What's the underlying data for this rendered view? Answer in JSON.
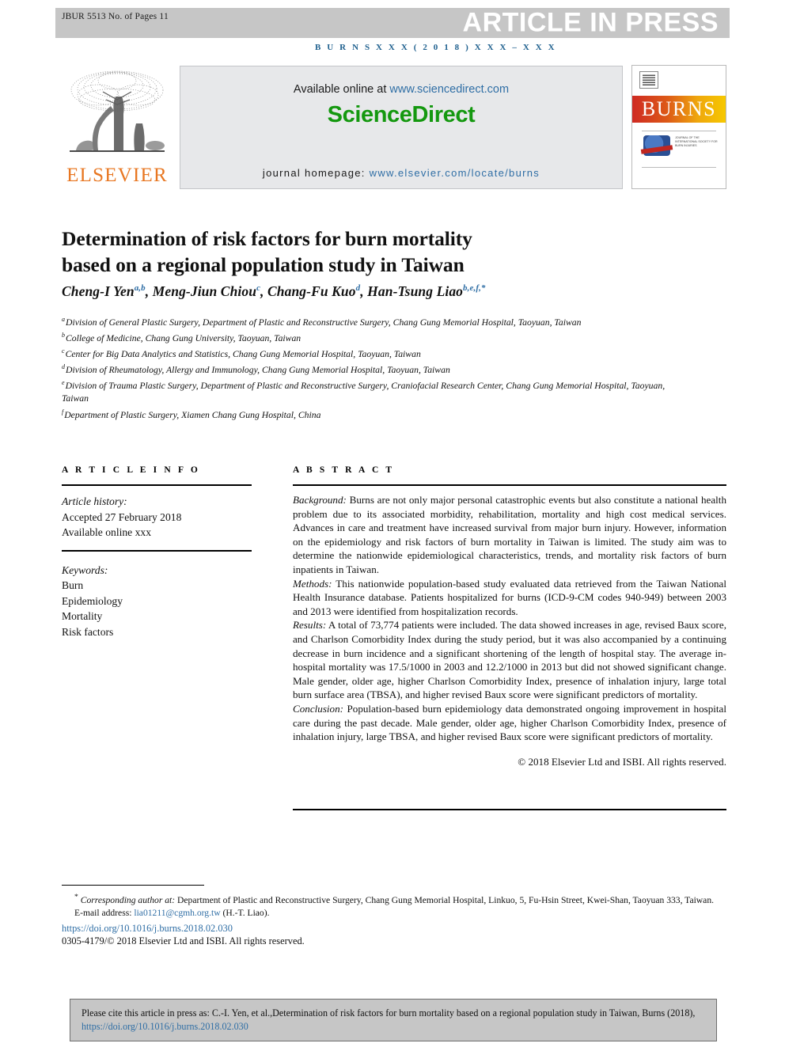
{
  "header": {
    "manuscript_id": "JBUR 5513 No. of Pages 11",
    "press_banner": "ARTICLE IN PRESS",
    "journal_ref": "B U R N S   X X X   ( 2 0 1 8 )   X X X – X X X"
  },
  "banner": {
    "publisher": "ELSEVIER",
    "available_prefix": "Available online at ",
    "available_link": "www.sciencedirect.com",
    "sciencedirect_logo": "ScienceDirect",
    "homepage_prefix": "journal homepage: ",
    "homepage_link": "www.elsevier.com/locate/burns",
    "cover_title": "BURNS",
    "cover_society": "JOURNAL OF THE INTERNATIONAL SOCIETY FOR BURN INJURIES",
    "colors": {
      "press_band": "#c6c6c6",
      "link_blue": "#2f6ea5",
      "sciencedirect_green": "#14980f",
      "elsevier_orange": "#e87722",
      "cover_band_start": "#cf2a23",
      "cover_band_end": "#f6c800"
    }
  },
  "article": {
    "title_line1": "Determination of risk factors for burn mortality",
    "title_line2": "based on a regional population study in Taiwan",
    "authors": [
      {
        "name": "Cheng-I Yen",
        "marks": "a,b",
        "sep": ", "
      },
      {
        "name": "Meng-Jiun Chiou",
        "marks": "c",
        "sep": ", "
      },
      {
        "name": "Chang-Fu Kuo",
        "marks": "d",
        "sep": ", "
      },
      {
        "name": "Han-Tsung Liao",
        "marks": "b,e,f,*",
        "sep": ""
      }
    ],
    "affiliations": [
      {
        "mark": "a",
        "text": "Division of General Plastic Surgery, Department of Plastic and Reconstructive Surgery, Chang Gung Memorial Hospital, Taoyuan, Taiwan"
      },
      {
        "mark": "b",
        "text": "College of Medicine, Chang Gung University, Taoyuan, Taiwan"
      },
      {
        "mark": "c",
        "text": "Center for Big Data Analytics and Statistics, Chang Gung Memorial Hospital, Taoyuan, Taiwan"
      },
      {
        "mark": "d",
        "text": "Division of Rheumatology, Allergy and Immunology, Chang Gung Memorial Hospital, Taoyuan, Taiwan"
      },
      {
        "mark": "e",
        "text": "Division of Trauma Plastic Surgery, Department of Plastic and Reconstructive Surgery, Craniofacial Research Center, Chang Gung Memorial Hospital, Taoyuan, Taiwan"
      },
      {
        "mark": "f",
        "text": "Department of Plastic Surgery, Xiamen Chang Gung Hospital, China"
      }
    ]
  },
  "article_info": {
    "heading": "A R T I C L E   I N F O",
    "history_label": "Article history:",
    "accepted": "Accepted 27 February 2018",
    "available_online": "Available online xxx",
    "keywords_label": "Keywords:",
    "keywords": [
      "Burn",
      "Epidemiology",
      "Mortality",
      "Risk factors"
    ]
  },
  "abstract": {
    "heading": "A B S T R A C T",
    "sections": [
      {
        "label": "Background:",
        "text": " Burns are not only major personal catastrophic events but also constitute a national health problem due to its associated morbidity, rehabilitation, mortality and high cost medical services. Advances in care and treatment have increased survival from major burn injury. However, information on the epidemiology and risk factors of burn mortality in Taiwan is limited. The study aim was to determine the nationwide epidemiological characteristics, trends, and mortality risk factors of burn inpatients in Taiwan."
      },
      {
        "label": "Methods:",
        "text": " This nationwide population-based study evaluated data retrieved from the Taiwan National Health Insurance database. Patients hospitalized for burns (ICD-9-CM codes 940-949) between 2003 and 2013 were identified from hospitalization records."
      },
      {
        "label": "Results:",
        "text": " A total of 73,774 patients were included. The data showed increases in age, revised Baux score, and Charlson Comorbidity Index during the study period, but it was also accompanied by a continuing decrease in burn incidence and a significant shortening of the length of hospital stay. The average in-hospital mortality was 17.5/1000 in 2003 and 12.2/1000 in 2013 but did not showed significant change. Male gender, older age, higher Charlson Comorbidity Index, presence of inhalation injury, large total burn surface area (TBSA), and higher revised Baux score were significant predictors of mortality."
      },
      {
        "label": "Conclusion:",
        "text": " Population-based burn epidemiology data demonstrated ongoing improvement in hospital care during the past decade. Male gender, older age, higher Charlson Comorbidity Index, presence of inhalation injury, large TBSA, and higher revised Baux score were significant predictors of mortality."
      }
    ],
    "copyright": "© 2018 Elsevier Ltd and ISBI. All rights reserved."
  },
  "footnotes": {
    "corresponding_marker": "*",
    "corresponding_label": "Corresponding author at:",
    "corresponding_text": " Department of Plastic and Reconstructive Surgery, Chang Gung Memorial Hospital, Linkuo, 5, Fu-Hsin Street, Kwei-Shan, Taoyuan 333, Taiwan.",
    "email_label": "E-mail address:",
    "email": "lia01211@cgmh.org.tw",
    "email_suffix": " (H.-T. Liao).",
    "doi": "https://doi.org/10.1016/j.burns.2018.02.030",
    "issn_line": "0305-4179/© 2018 Elsevier Ltd and ISBI. All rights reserved."
  },
  "cite_box": {
    "text": "Please cite this article in press as: C.-I. Yen, et al.,Determination of risk factors for burn mortality based on a regional population study in Taiwan, Burns (2018), ",
    "link": "https://doi.org/10.1016/j.burns.2018.02.030"
  }
}
